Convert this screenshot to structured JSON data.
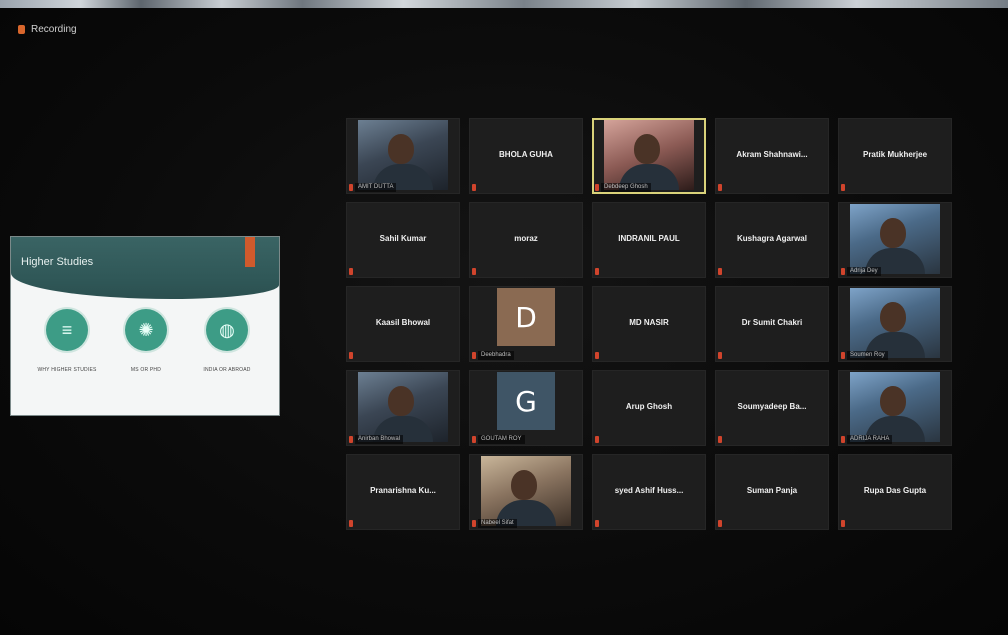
{
  "recording": {
    "label": "Recording"
  },
  "shared_screen": {
    "title": "Higher Studies",
    "items": [
      {
        "label": "WHY HIGHER STUDIES",
        "icon": "books-icon"
      },
      {
        "label": "MS OR PHD",
        "icon": "atom-icon"
      },
      {
        "label": "INDIA OR ABROAD",
        "icon": "globe-icon"
      }
    ]
  },
  "participants": [
    {
      "name": "",
      "label": "AMIT DUTTA",
      "type": "video",
      "active": false
    },
    {
      "name": "BHOLA GUHA",
      "label": "",
      "type": "name",
      "active": false
    },
    {
      "name": "",
      "label": "Debdeep Ghosh",
      "type": "video",
      "active": true
    },
    {
      "name": "Akram Shahnawi...",
      "label": "",
      "type": "name",
      "active": false
    },
    {
      "name": "Pratik Mukherjee",
      "label": "",
      "type": "name",
      "active": false
    },
    {
      "name": "Sahil Kumar",
      "label": "",
      "type": "name",
      "active": false
    },
    {
      "name": "moraz",
      "label": "",
      "type": "name",
      "active": false
    },
    {
      "name": "INDRANIL PAUL",
      "label": "",
      "type": "name",
      "active": false
    },
    {
      "name": "Kushagra Agarwal",
      "label": "",
      "type": "name",
      "active": false
    },
    {
      "name": "",
      "label": "Adrija Dey",
      "type": "video",
      "active": false
    },
    {
      "name": "Kaasil Bhowal",
      "label": "",
      "type": "name",
      "active": false
    },
    {
      "name": "",
      "label": "Deebhadra",
      "type": "avatar",
      "avatar": "D",
      "active": false
    },
    {
      "name": "MD NASIR",
      "label": "",
      "type": "name",
      "active": false
    },
    {
      "name": "Dr Sumit Chakri",
      "label": "",
      "type": "name",
      "active": false
    },
    {
      "name": "",
      "label": "Soumen Roy",
      "type": "video",
      "active": false
    },
    {
      "name": "",
      "label": "Anirban Bhowal",
      "type": "video",
      "active": false
    },
    {
      "name": "",
      "label": "GOUTAM ROY",
      "type": "avatar",
      "avatar": "G",
      "active": false
    },
    {
      "name": "Arup Ghosh",
      "label": "",
      "type": "name",
      "active": false
    },
    {
      "name": "Soumyadeep Ba...",
      "label": "",
      "type": "name",
      "active": false
    },
    {
      "name": "",
      "label": "ADRIJA RAHA",
      "type": "video",
      "active": false
    },
    {
      "name": "Pranarishna Ku...",
      "label": "",
      "type": "name",
      "active": false
    },
    {
      "name": "",
      "label": "Nabeel Sifat",
      "type": "video",
      "active": false
    },
    {
      "name": "syed Ashif Huss...",
      "label": "",
      "type": "name",
      "active": false
    },
    {
      "name": "Suman Panja",
      "label": "",
      "type": "name",
      "active": false
    },
    {
      "name": "Rupa Das Gupta",
      "label": "",
      "type": "name",
      "active": false
    }
  ],
  "colors": {
    "background": "#0a0a0a",
    "tile": "#1e1e1e",
    "active_border": "#d9d27a",
    "mic_muted": "#d0442c",
    "teal": "#2f5757",
    "circle": "#3d9c86"
  }
}
